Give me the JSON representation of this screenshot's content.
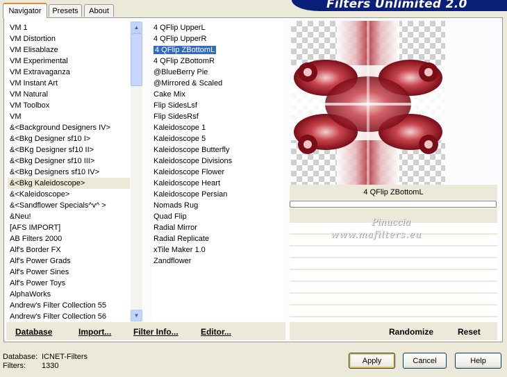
{
  "tabs": [
    {
      "label": "Navigator",
      "active": true
    },
    {
      "label": "Presets",
      "active": false
    },
    {
      "label": "About",
      "active": false
    }
  ],
  "banner": {
    "title": "Filters Unlimited 2.0"
  },
  "categories": [
    "VM 1",
    "VM Distortion",
    "VM Elisablaze",
    "VM Experimental",
    "VM Extravaganza",
    "VM Instant Art",
    "VM Natural",
    "VM Toolbox",
    "VM",
    "&<Background Designers IV>",
    "&<Bkg Designer sf10 I>",
    "&<BKg Designer sf10 II>",
    "&<Bkg Designer sf10 III>",
    "&<Bkg Designers sf10 IV>",
    "&<Bkg Kaleidoscope>",
    "&<Kaleidoscope>",
    "&<Sandflower Specials^v^ >",
    "&Neu!",
    "[AFS IMPORT]",
    "AB Filters 2000",
    "Alf's Border FX",
    "Alf's Power Grads",
    "Alf's Power Sines",
    "Alf's Power Toys",
    "AlphaWorks",
    "Andrew's Filter Collection 55",
    "Andrew's Filter Collection 56"
  ],
  "selected_category": "&<Bkg Kaleidoscope>",
  "filters": [
    "4 QFlip UpperL",
    "4 QFlip UpperR",
    "4 QFlip ZBottomL",
    "4 QFlip ZBottomR",
    "@BlueBerry Pie",
    "@Mirrored & Scaled",
    "Cake Mix",
    "Flip SidesLsf",
    "Flip SidesRsf",
    "Kaleidoscope 1",
    "Kaleidoscope 5",
    "Kaleidoscope Butterfly",
    "Kaleidoscope Divisions",
    "Kaleidoscope Flower",
    "Kaleidoscope Heart",
    "Kaleidoscope Persian",
    "Nomads Rug",
    "Quad Flip",
    "Radial Mirror",
    "Radial Replicate",
    "xTile Maker 1.0",
    "Zandflower"
  ],
  "selected_filter": "4 QFlip ZBottomL",
  "preview": {
    "filter_name": "4 QFlip ZBottomL",
    "progress": 0
  },
  "watermark": {
    "line1": "Pinuccia",
    "line2": "www.mafilters.eu"
  },
  "toolbar": {
    "database": "Database",
    "import": "Import...",
    "filter_info": "Filter Info...",
    "editor": "Editor...",
    "randomize": "Randomize",
    "reset": "Reset"
  },
  "status": {
    "database_label": "Database:",
    "database_value": "ICNET-Filters",
    "filters_label": "Filters:",
    "filters_value": "1330"
  },
  "dialog": {
    "apply": "Apply",
    "cancel": "Cancel",
    "help": "Help"
  },
  "colors": {
    "selection": "#316ac5",
    "banner": "#0a1f7a",
    "tab_accent": "#e68b2c"
  }
}
